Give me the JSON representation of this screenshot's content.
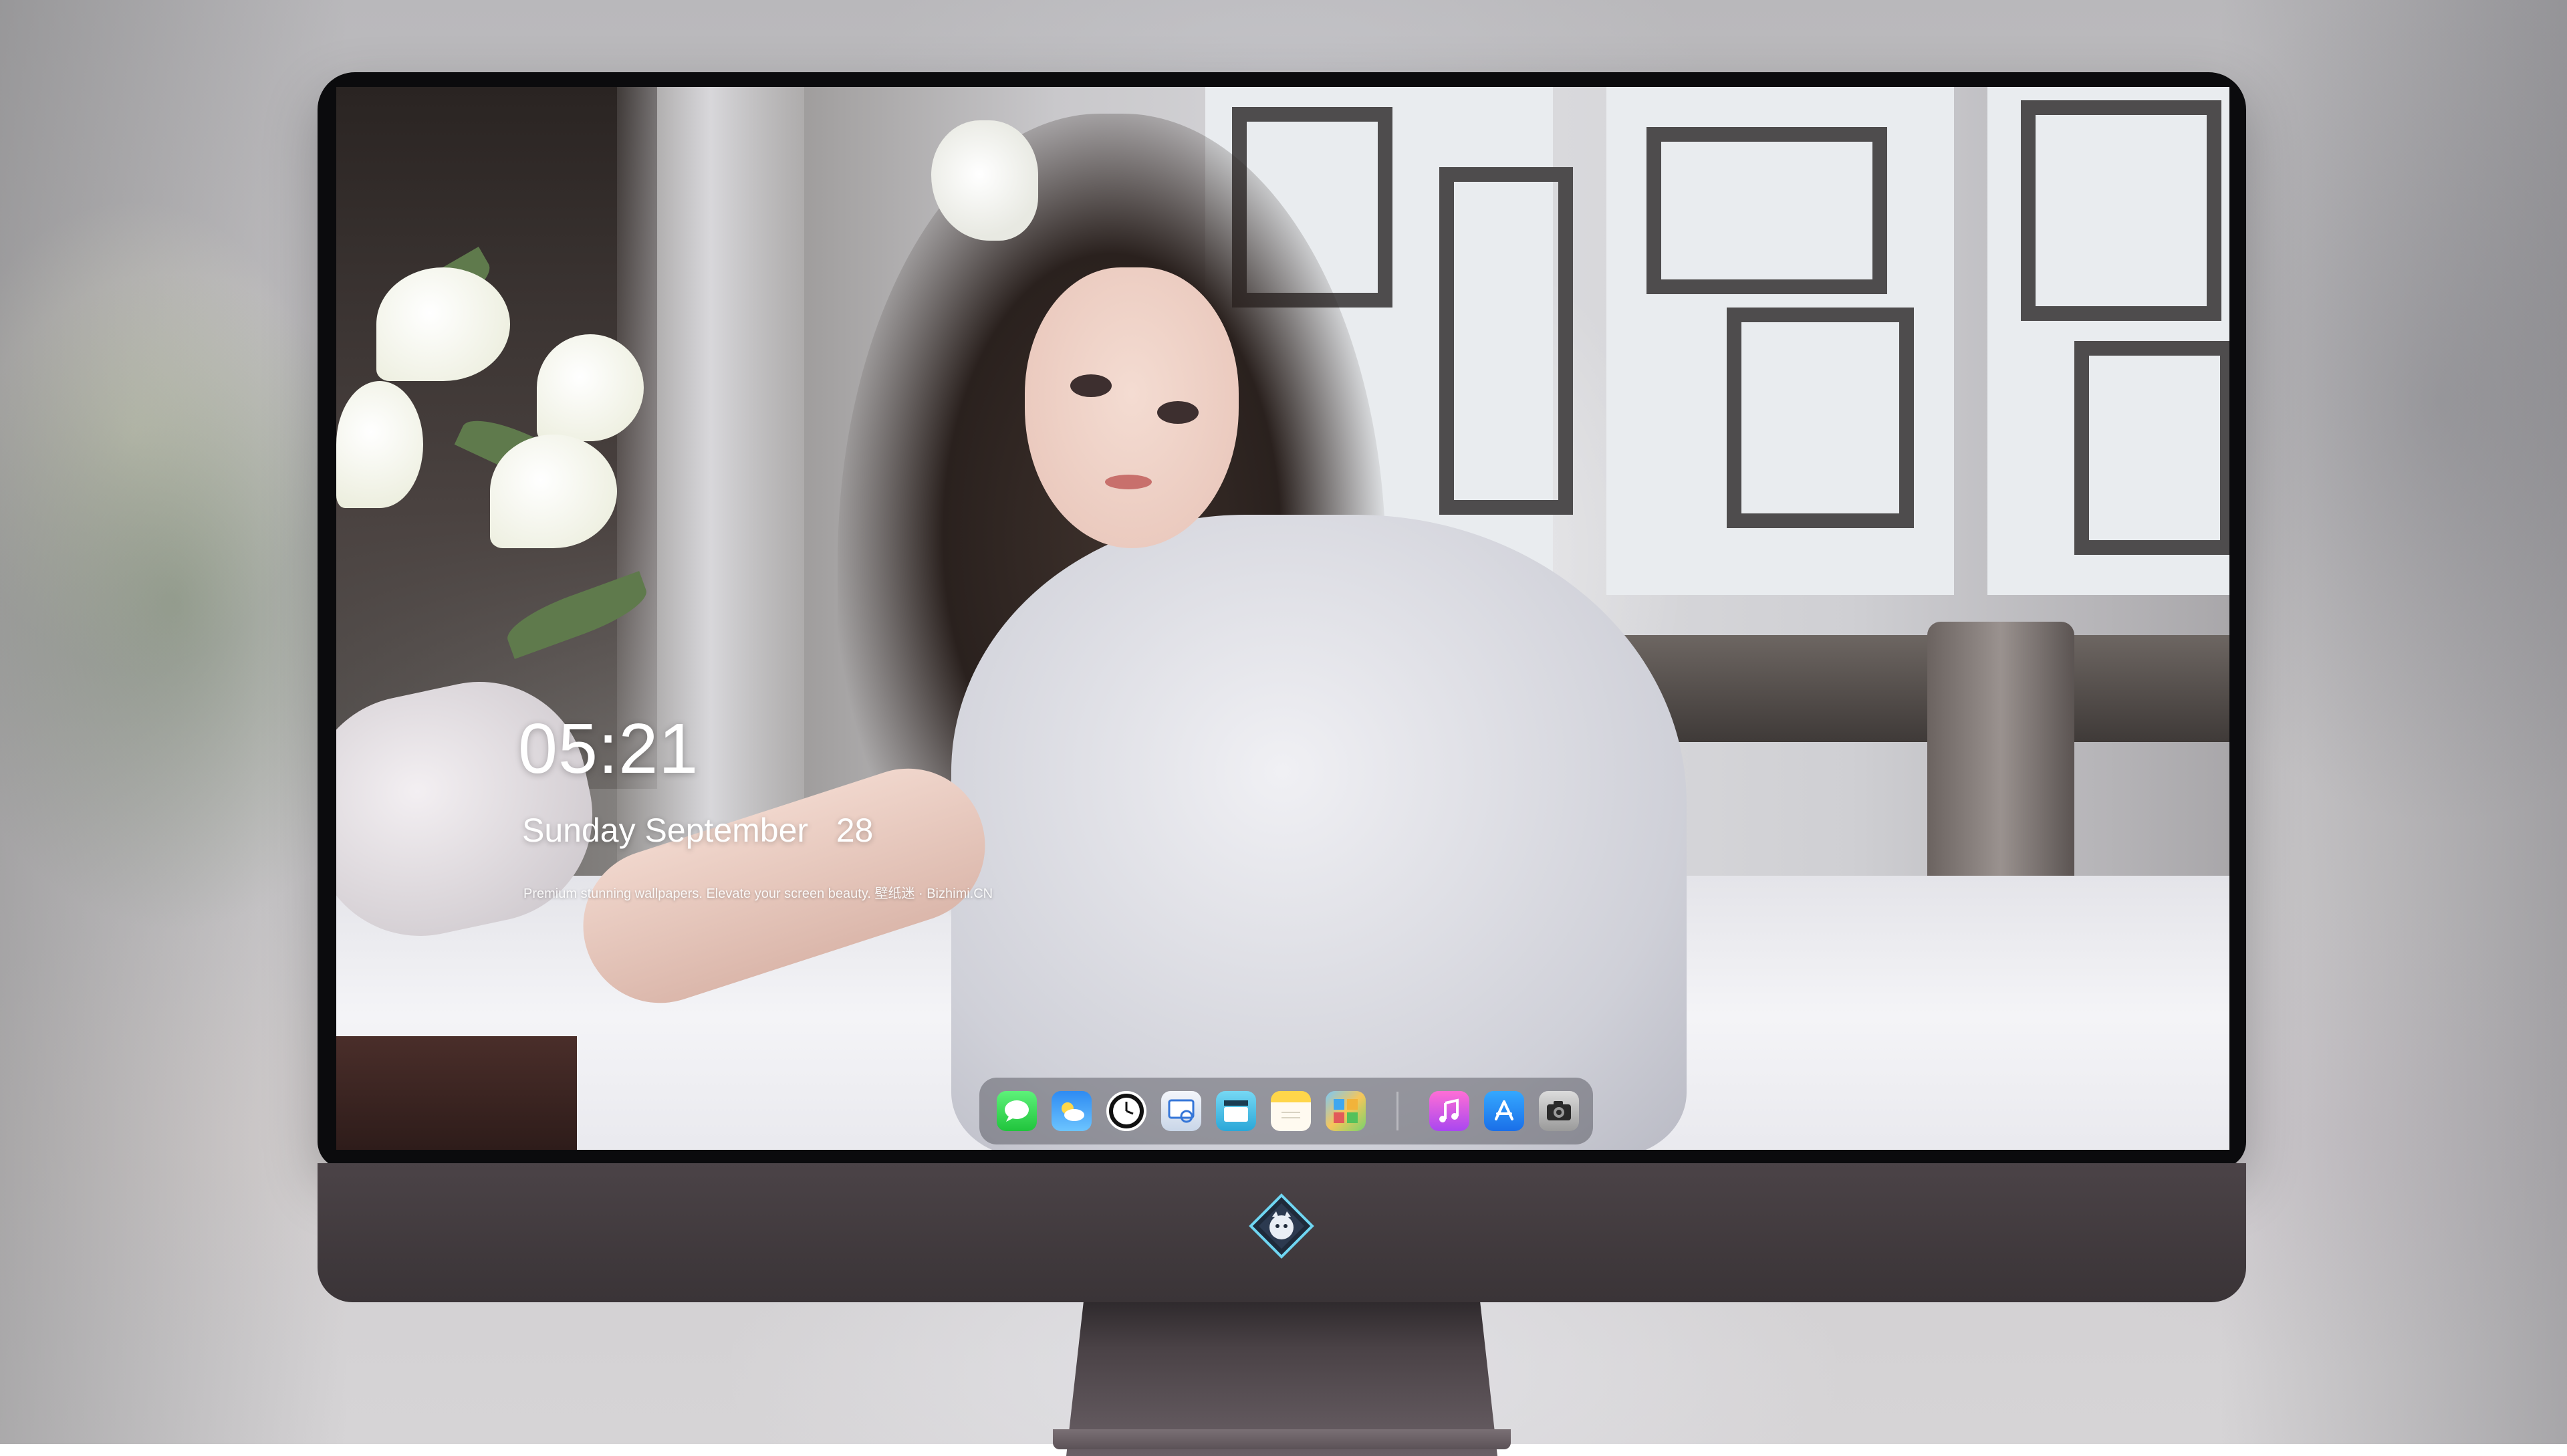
{
  "lock_screen": {
    "time": "05:21",
    "date": "Sunday September   28",
    "tagline": "Premium stunning wallpapers. Elevate your screen beauty. 壁纸迷 · Bizhimi.CN"
  },
  "dock": {
    "apps": [
      {
        "name": "Messages",
        "icon": "messages-icon"
      },
      {
        "name": "Weather",
        "icon": "weather-icon"
      },
      {
        "name": "Clock",
        "icon": "clock-icon"
      },
      {
        "name": "Preview",
        "icon": "preview-icon"
      },
      {
        "name": "Claquette",
        "icon": "claquette-icon"
      },
      {
        "name": "Notes",
        "icon": "notes-icon"
      },
      {
        "name": "Photos",
        "icon": "photos-icon"
      },
      {
        "name": "Music",
        "icon": "music-icon"
      },
      {
        "name": "App Store",
        "icon": "app-store-icon"
      },
      {
        "name": "Camera",
        "icon": "camera-icon"
      }
    ]
  },
  "monitor": {
    "logo": "dragon-logo-icon"
  },
  "colors": {
    "dock_background": "#46465073",
    "chin": "#433c40",
    "frame": "#0b0b0d",
    "clock_text": "#ffffff"
  }
}
